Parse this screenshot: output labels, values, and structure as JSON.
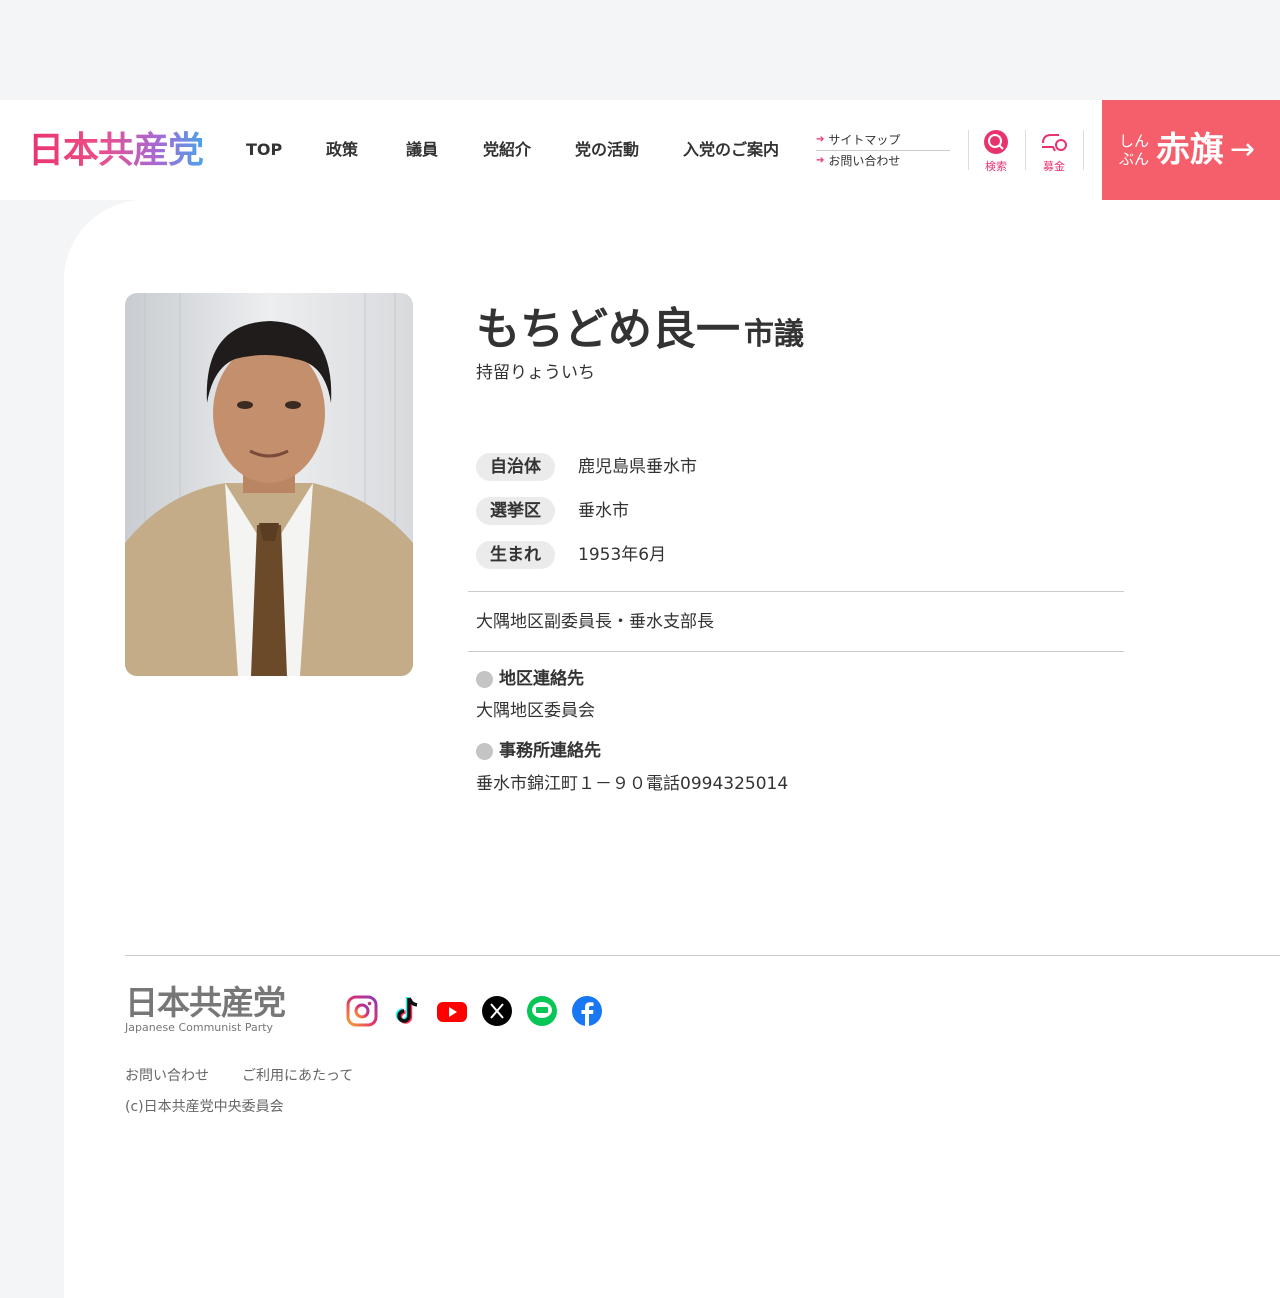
{
  "header": {
    "logo": "日本共産党",
    "nav": [
      "TOP",
      "政策",
      "議員",
      "党紹介",
      "党の活動",
      "入党のご案内"
    ],
    "subnav": [
      "サイトマップ",
      "お問い合わせ"
    ],
    "search_label": "検索",
    "donate_label": "募金",
    "akahata_small_1": "しん",
    "akahata_small_2": "ぶん",
    "akahata_big": "赤旗",
    "akahata_arrow": "→"
  },
  "profile": {
    "name": "もちどめ良一",
    "title": "市議",
    "kana": "持留りょういち",
    "details": [
      {
        "label": "自治体",
        "value": "鹿児島県垂水市"
      },
      {
        "label": "選挙区",
        "value": "垂水市"
      },
      {
        "label": "生まれ",
        "value": "1953年6月"
      }
    ],
    "role": "大隅地区副委員長・垂水支部長",
    "contacts": [
      {
        "title": "地区連絡先",
        "value": "大隅地区委員会"
      },
      {
        "title": "事務所連絡先",
        "value": "垂水市錦江町１－９０電話0994325014"
      }
    ]
  },
  "footer": {
    "logo_jp": "日本共産党",
    "logo_en": "Japanese Communist Party",
    "social": [
      "instagram-icon",
      "tiktok-icon",
      "youtube-icon",
      "x-icon",
      "line-icon",
      "facebook-icon"
    ],
    "links": [
      "お問い合わせ",
      "ご利用にあたって"
    ],
    "copyright": "(c)日本共産党中央委員会"
  },
  "colors": {
    "accent": "#e8336d",
    "akahata": "#f45f6b"
  }
}
